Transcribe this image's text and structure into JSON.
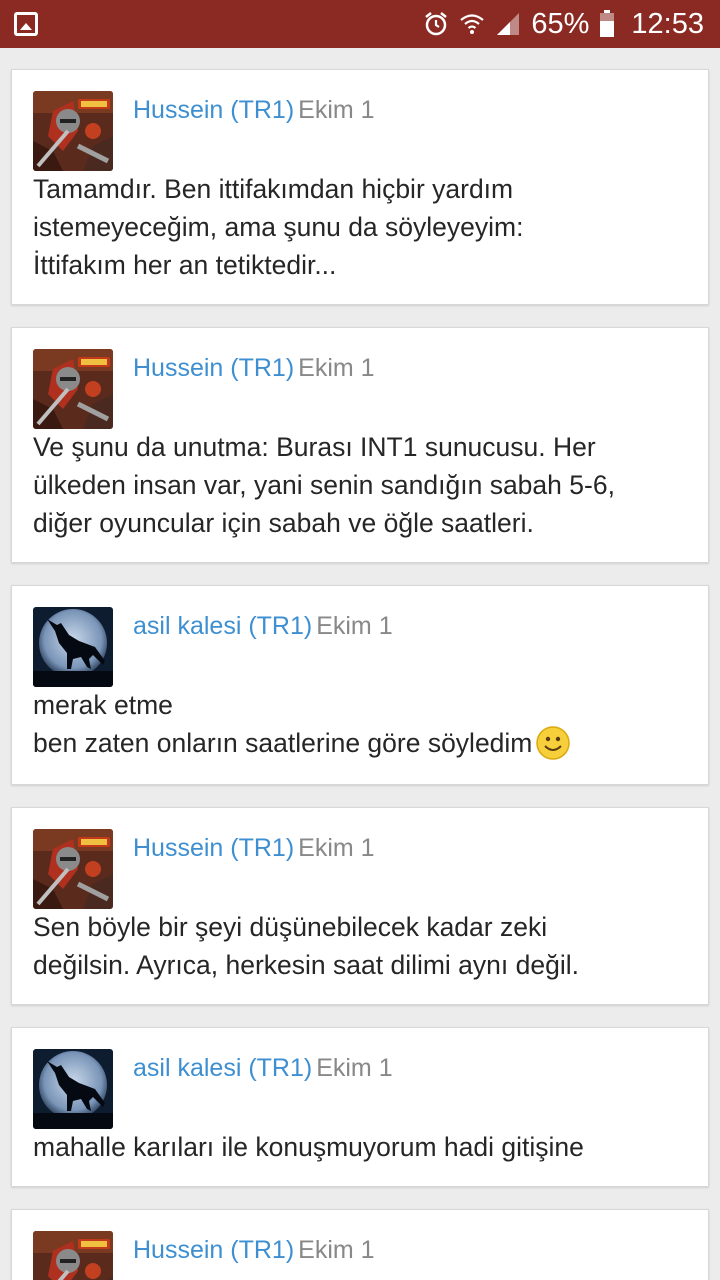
{
  "status_bar": {
    "battery": "65%",
    "time": "12:53",
    "icons": [
      "gallery-icon",
      "alarm-icon",
      "wifi-icon",
      "signal-icon",
      "battery-icon"
    ]
  },
  "colors": {
    "status_bar_bg": "#8b2a23",
    "author_link": "#3d8fd1",
    "date_text": "#888888",
    "body_text": "#262626"
  },
  "posts": [
    {
      "author": "Hussein (TR1)",
      "date": "Ekim 1",
      "avatar": "empire-warrior-avatar",
      "lines": [
        "Tamamdır. Ben ittifakımdan hiçbir yardım",
        "istemeyeceğim, ama şunu da söyleyeyim:",
        "İttifakım her an tetiktedir..."
      ]
    },
    {
      "author": "Hussein (TR1)",
      "date": "Ekim 1",
      "avatar": "empire-warrior-avatar",
      "lines": [
        "Ve şunu da unutma: Burası INT1 sunucusu. Her",
        "ülkeden insan var, yani senin sandığın sabah 5-6,",
        "diğer oyuncular için sabah ve öğle saatleri."
      ]
    },
    {
      "author": "asil kalesi (TR1)",
      "date": "Ekim 1",
      "avatar": "howling-wolf-moon-avatar",
      "lines": [
        "merak etme",
        "ben zaten onların saatlerine göre söyledim"
      ],
      "emoji": "smiley-emoji"
    },
    {
      "author": "Hussein (TR1)",
      "date": "Ekim 1",
      "avatar": "empire-warrior-avatar",
      "lines": [
        "Sen böyle bir şeyi düşünebilecek kadar zeki",
        "değilsin. Ayrıca, herkesin saat dilimi aynı değil."
      ]
    },
    {
      "author": "asil kalesi (TR1)",
      "date": "Ekim 1",
      "avatar": "howling-wolf-moon-avatar",
      "lines": [
        "mahalle karıları ile konuşmuyorum hadi gitişine"
      ]
    },
    {
      "author": "Hussein (TR1)",
      "date": "Ekim 1",
      "avatar": "empire-warrior-avatar",
      "lines": []
    }
  ]
}
